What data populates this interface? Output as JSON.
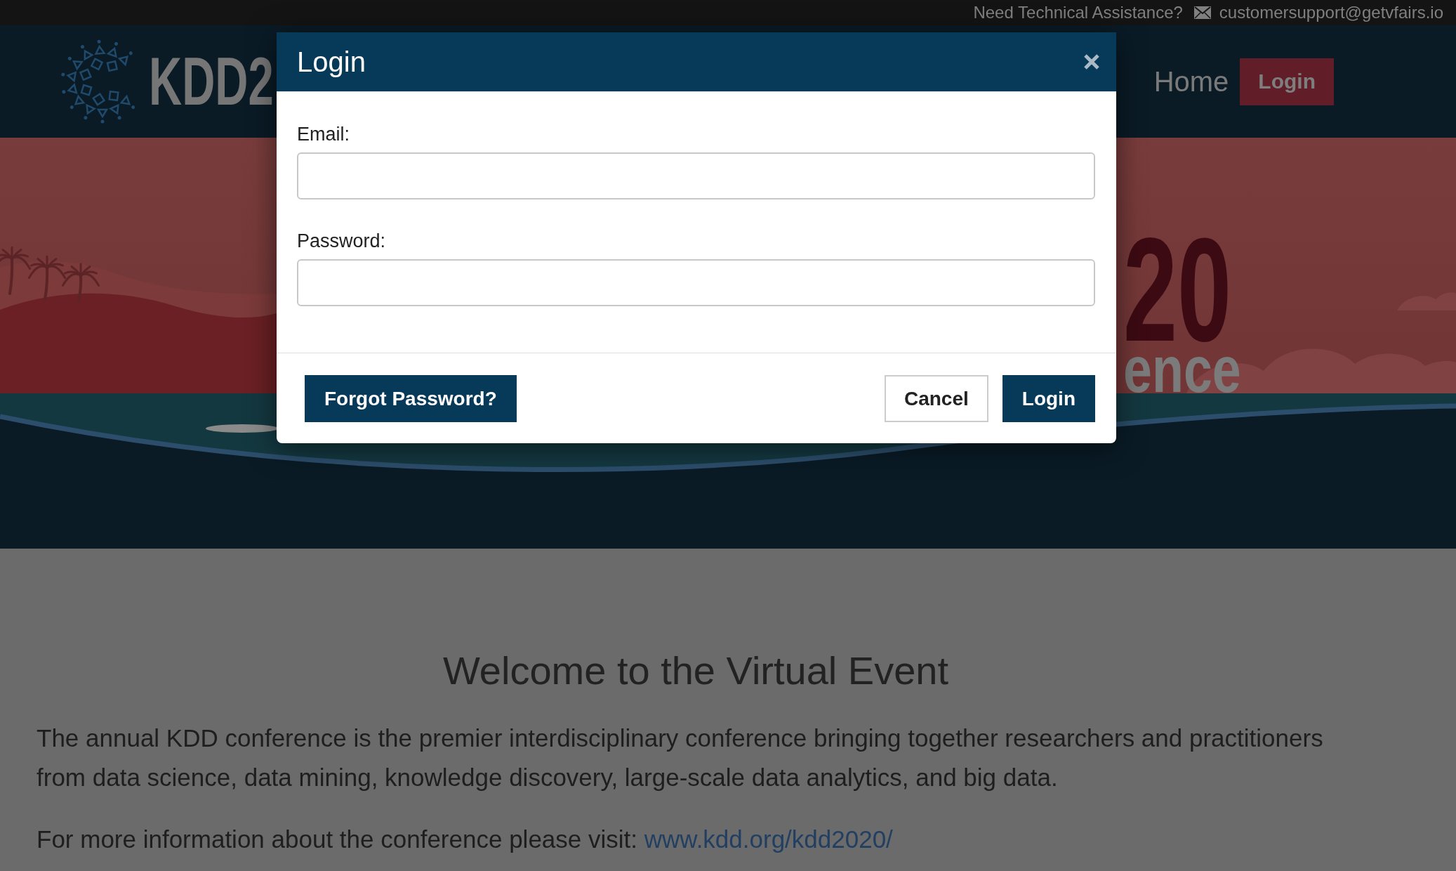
{
  "top_bar": {
    "help_text": "Need Technical Assistance?",
    "email": "customersupport@getvfairs.io"
  },
  "header": {
    "logo_text": "KDD2",
    "nav": [
      {
        "label": "Home",
        "kind": "link"
      },
      {
        "label": "Login",
        "kind": "button"
      }
    ]
  },
  "banner": {
    "year_text": "20",
    "subtitle_text": "ence"
  },
  "content": {
    "heading": "Welcome to the Virtual Event",
    "paragraphs": [
      {
        "text": "The annual KDD conference is the premier interdisciplinary conference bringing together researchers and practitioners from data science, data mining, knowledge discovery, large-scale data analytics, and big data."
      },
      {
        "text": "For more information about the conference please visit:",
        "link": "www.kdd.org/kdd2020/"
      }
    ]
  },
  "login_dialog": {
    "title": "Login",
    "email_field": {
      "label": "Email:"
    },
    "password_field": {
      "label": "Password:"
    },
    "footer": {
      "start_buttons": [
        {
          "label": "Forgot Password?",
          "kind": "primary"
        }
      ],
      "end_buttons": [
        {
          "label": "Cancel",
          "kind": "secondary"
        },
        {
          "label": "Login",
          "kind": "primary"
        }
      ]
    }
  }
}
